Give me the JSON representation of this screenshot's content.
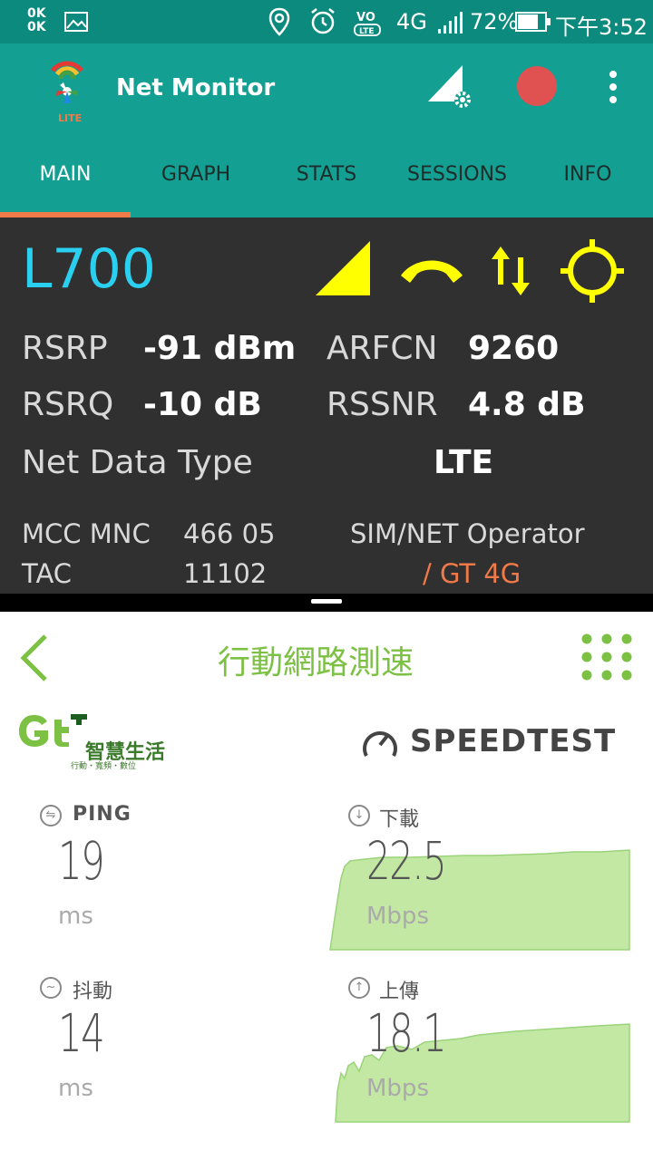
{
  "status_bar": {
    "ok_text": "0K\n0K",
    "network": "4G",
    "battery": "72%",
    "time": "下午3:52"
  },
  "app": {
    "title": "Net Monitor",
    "logo_badge": "LITE",
    "tabs": [
      "MAIN",
      "GRAPH",
      "STATS",
      "SESSIONS",
      "INFO"
    ],
    "active_tab": "MAIN",
    "colors": {
      "primary": "#139f91",
      "status": "#0c8a7d",
      "accent": "#f07a48",
      "record": "#e05252",
      "band": "#2ad0f0",
      "yellow": "#ffff00"
    }
  },
  "cell": {
    "band": "L700",
    "rsrp_label": "RSRP",
    "rsrp_value": "-91 dBm",
    "arfcn_label": "ARFCN",
    "arfcn_value": "9260",
    "rsrq_label": "RSRQ",
    "rsrq_value": "-10 dB",
    "rssnr_label": "RSSNR",
    "rssnr_value": "4.8 dB",
    "net_type_label": "Net Data Type",
    "net_type_value": "LTE",
    "mcc_label": "MCC MNC",
    "mcc_value": "466 05",
    "operator_label": "SIM/NET Operator",
    "tac_label": "TAC",
    "tac_value": "11102",
    "operator_value": "/ GT 4G"
  },
  "speedtest": {
    "header_title": "行動網路測速",
    "brand_cn": "智慧生活",
    "brand_sub": "行動・寬頻・數位",
    "speedtest_logo": "SPEEDTEST",
    "ping_label": "PING",
    "ping_value": "19",
    "ping_unit": "ms",
    "download_label": "下載",
    "download_value": "22.5",
    "download_unit": "Mbps",
    "jitter_label": "抖動",
    "jitter_value": "14",
    "jitter_unit": "ms",
    "upload_label": "上傳",
    "upload_value": "18.1",
    "upload_unit": "Mbps",
    "colors": {
      "green": "#7cc144",
      "chart_fill": "#c3e8a4"
    }
  }
}
